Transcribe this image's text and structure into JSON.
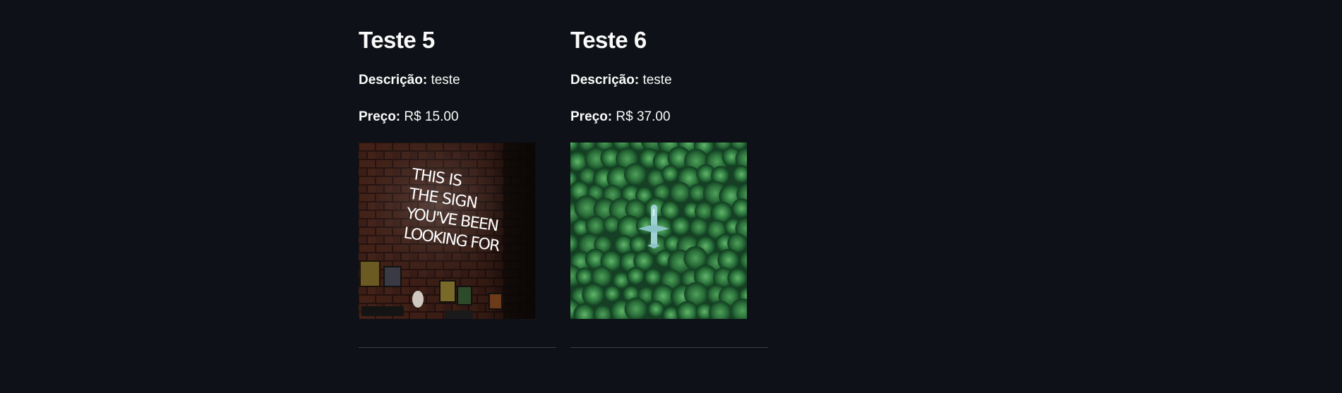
{
  "products": [
    {
      "title": "Teste 5",
      "description_label": "Descrição:",
      "description": "teste",
      "price_label": "Preço:",
      "price": "R$ 15.00",
      "image": "neon-sign-photo",
      "image_text": [
        "THIS IS",
        "THE SIGN",
        "YOU'VE BEEN",
        "LOOKING FOR"
      ]
    },
    {
      "title": "Teste 6",
      "description_label": "Descrição:",
      "description": "teste",
      "price_label": "Preço:",
      "price": "R$ 37.00",
      "image": "airplane-in-forest-photo"
    }
  ],
  "colors": {
    "background": "#0e1117",
    "text": "#fafafa",
    "divider": "#3d4048"
  }
}
